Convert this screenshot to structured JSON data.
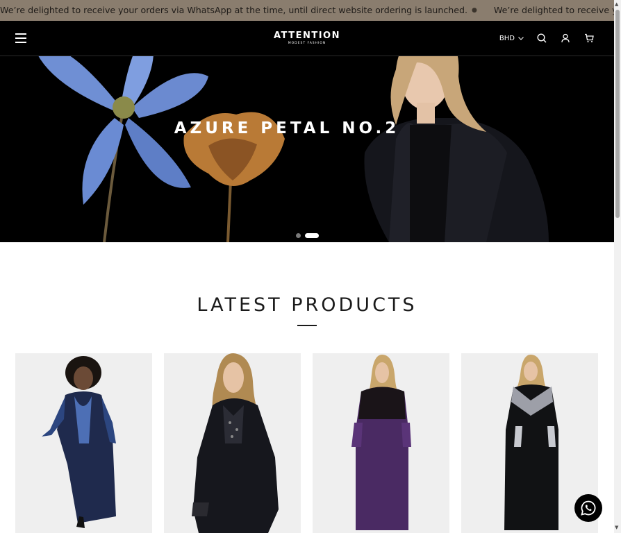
{
  "announcement": {
    "messages": [
      "We’re delighted to receive your orders via WhatsApp at the time, until direct website ordering is launched.",
      "We’re delighted to receive your orders via WhatsApp at the time, until direct website ordering is launched."
    ],
    "separator": "●"
  },
  "header": {
    "brand": "ATTENTION",
    "tagline": "MODEST FASHION",
    "currency": "BHD",
    "icons": [
      "menu-icon",
      "search-icon",
      "account-icon",
      "cart-icon"
    ]
  },
  "hero": {
    "title": "AZURE PETAL NO.2",
    "slide_count": 2,
    "active_slide": 2
  },
  "section": {
    "title": "LATEST PRODUCTS"
  },
  "colors": {
    "announcement_bg": "#8a7d6e",
    "header_bg": "#000000",
    "card_bg": "#efefef",
    "accent": "#ffffff"
  }
}
